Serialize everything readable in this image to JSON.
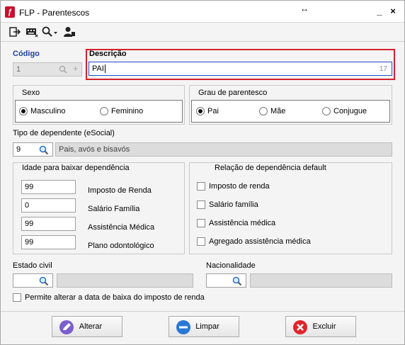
{
  "window": {
    "title": "FLP - Parentescos",
    "minimize": "_",
    "close": "×",
    "resize_glyph": "↔"
  },
  "toolbar": {
    "icons": [
      "exit-icon",
      "keyboard-icon",
      "search-dropdown-icon",
      "user-icon"
    ]
  },
  "codigo": {
    "label": "Código",
    "value": "1"
  },
  "descricao": {
    "label": "Descrição",
    "value": "PAI",
    "counter": "17"
  },
  "sexo": {
    "title": "Sexo",
    "options": [
      "Masculino",
      "Feminino"
    ],
    "selected": "Masculino"
  },
  "grau": {
    "title": "Grau de parentesco",
    "options": [
      "Pai",
      "Mãe",
      "Conjugue"
    ],
    "selected": "Pai"
  },
  "tipo_dependente": {
    "label": "Tipo de dependente (eSocial)",
    "code": "9",
    "description": "Pais, avós e bisavós"
  },
  "idade": {
    "title": "Idade para baixar dependência",
    "rows": [
      {
        "value": "99",
        "label": "Imposto de Renda"
      },
      {
        "value": "0",
        "label": "Salário Família"
      },
      {
        "value": "99",
        "label": "Assistência Médica"
      },
      {
        "value": "99",
        "label": "Plano odontológico"
      }
    ]
  },
  "relacao": {
    "title": "Relação de dependência default",
    "items": [
      "Imposto de renda",
      "Salário família",
      "Assistência médica",
      "Agregado assistência médica"
    ]
  },
  "estado_civil": {
    "label": "Estado civil",
    "value": "",
    "description": ""
  },
  "nacionalidade": {
    "label": "Nacionalidade",
    "value": "",
    "description": ""
  },
  "permite": {
    "label": "Permite alterar a data de baixa do imposto de renda"
  },
  "buttons": {
    "alterar": "Alterar",
    "limpar": "Limpar",
    "excluir": "Excluir"
  },
  "colors": {
    "accent_label": "#1f3fa3",
    "focus_border": "#d6202c",
    "excluir_icon": "#e0242c",
    "limpar_icon": "#2a78d6",
    "alterar_icon": "#6b4fc4"
  }
}
